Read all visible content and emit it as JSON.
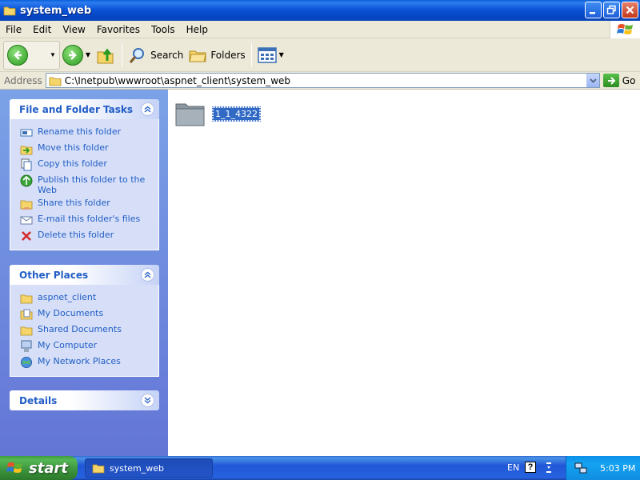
{
  "window": {
    "title": "system_web"
  },
  "menubar": {
    "items": [
      "File",
      "Edit",
      "View",
      "Favorites",
      "Tools",
      "Help"
    ]
  },
  "toolbar": {
    "back_label": "Back",
    "search_label": "Search",
    "folders_label": "Folders"
  },
  "address": {
    "label": "Address",
    "path": "C:\\Inetpub\\wwwroot\\aspnet_client\\system_web",
    "go_label": "Go"
  },
  "task_pane": {
    "file_folder_tasks": {
      "title": "File and Folder Tasks",
      "items": [
        {
          "label": "Rename this folder",
          "icon": "rename-icon"
        },
        {
          "label": "Move this folder",
          "icon": "move-icon"
        },
        {
          "label": "Copy this folder",
          "icon": "copy-icon"
        },
        {
          "label": "Publish this folder to the Web",
          "icon": "publish-icon"
        },
        {
          "label": "Share this folder",
          "icon": "share-icon"
        },
        {
          "label": "E-mail this folder's files",
          "icon": "email-icon"
        },
        {
          "label": "Delete this folder",
          "icon": "delete-icon"
        }
      ]
    },
    "other_places": {
      "title": "Other Places",
      "items": [
        {
          "label": "aspnet_client",
          "icon": "folder-icon"
        },
        {
          "label": "My Documents",
          "icon": "my-documents-icon"
        },
        {
          "label": "Shared Documents",
          "icon": "shared-documents-icon"
        },
        {
          "label": "My Computer",
          "icon": "my-computer-icon"
        },
        {
          "label": "My Network Places",
          "icon": "network-places-icon"
        }
      ]
    },
    "details": {
      "title": "Details"
    }
  },
  "content": {
    "items": [
      {
        "name": "1_1_4322",
        "type": "folder",
        "selected": true
      }
    ]
  },
  "taskbar": {
    "start_label": "start",
    "task_button_label": "system_web",
    "language": "EN",
    "clock": "5:03 PM"
  },
  "colors": {
    "titlebar": "#0b55d6",
    "taskpane_link": "#215dc6",
    "selection": "#316ac5",
    "start_green": "#3b923b"
  }
}
